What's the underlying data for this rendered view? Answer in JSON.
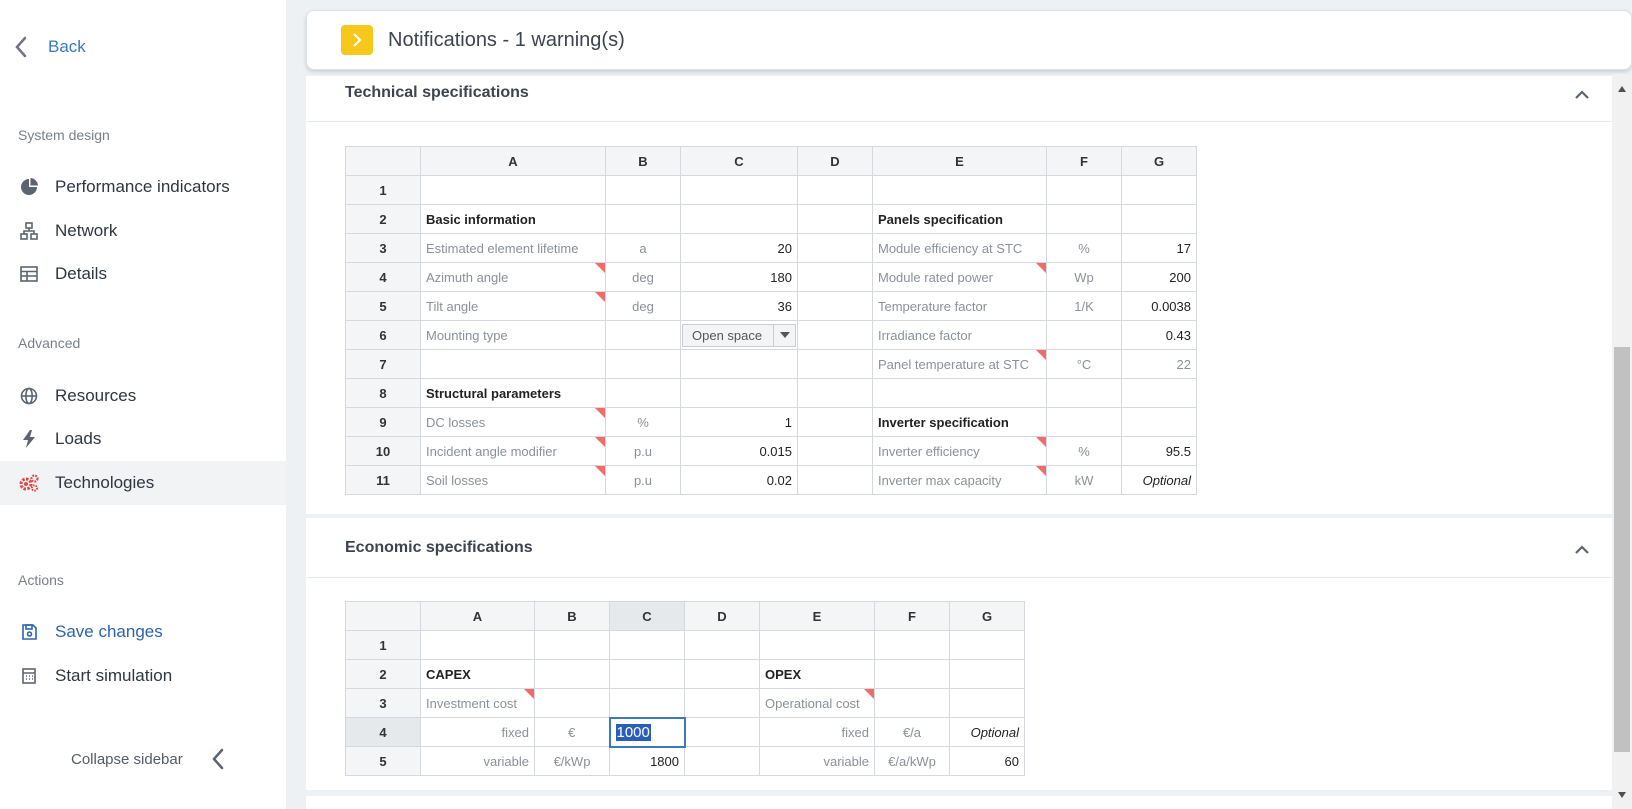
{
  "sidebar": {
    "back_label": "Back",
    "sections": {
      "system_design": "System design",
      "advanced": "Advanced",
      "actions": "Actions"
    },
    "items": {
      "performance": "Performance indicators",
      "network": "Network",
      "details": "Details",
      "resources": "Resources",
      "loads": "Loads",
      "technologies": "Technologies",
      "save": "Save changes",
      "start": "Start simulation"
    },
    "collapse_label": "Collapse sidebar"
  },
  "notifications": {
    "title": "Notifications - 1 warning(s)"
  },
  "technical": {
    "title": "Technical specifications",
    "columns": [
      "A",
      "B",
      "C",
      "D",
      "E",
      "F",
      "G"
    ],
    "rows": {
      "r2": {
        "a": "Basic information",
        "e": "Panels specification"
      },
      "r3": {
        "a": "Estimated element lifetime",
        "b": "a",
        "c": "20",
        "e": "Module efficiency at STC",
        "f": "%",
        "g": "17"
      },
      "r4": {
        "a": "Azimuth angle",
        "b": "deg",
        "c": "180",
        "e": "Module rated power",
        "f": "Wp",
        "g": "200"
      },
      "r5": {
        "a": "Tilt angle",
        "b": "deg",
        "c": "36",
        "e": "Temperature factor",
        "f": "1/K",
        "g": "0.0038"
      },
      "r6": {
        "a": "Mounting type",
        "c": "Open space",
        "e": "Irradiance factor",
        "g": "0.43"
      },
      "r7": {
        "e": "Panel temperature at STC",
        "f": "°C",
        "g": "22"
      },
      "r8": {
        "a": "Structural parameters"
      },
      "r9": {
        "a": "DC losses",
        "b": "%",
        "c": "1",
        "e": "Inverter specification"
      },
      "r10": {
        "a": "Incident angle modifier",
        "b": "p.u",
        "c": "0.015",
        "e": "Inverter efficiency",
        "f": "%",
        "g": "95.5"
      },
      "r11": {
        "a": "Soil losses",
        "b": "p.u",
        "c": "0.02",
        "e": "Inverter max capacity",
        "f": "kW",
        "g": "Optional"
      }
    }
  },
  "economic": {
    "title": "Economic specifications",
    "columns": [
      "A",
      "B",
      "C",
      "D",
      "E",
      "F",
      "G"
    ],
    "rows": {
      "r2": {
        "a": "CAPEX",
        "e": "OPEX"
      },
      "r3": {
        "a": "Investment cost",
        "e": "Operational cost"
      },
      "r4": {
        "a": "fixed",
        "b": "€",
        "c": "1000",
        "e": "fixed",
        "f": "€/a",
        "g": "Optional"
      },
      "r5": {
        "a": "variable",
        "b": "€/kWp",
        "c": "1800",
        "e": "variable",
        "f": "€/a/kWp",
        "g": "60"
      }
    }
  },
  "colors": {
    "accent_blue": "#3a78c2",
    "warning_yellow": "#f7c71a",
    "flag_red": "#f26b6b"
  },
  "icons": [
    "chevron-left-icon",
    "pie-chart-icon",
    "network-icon",
    "table-icon",
    "globe-icon",
    "lightning-icon",
    "gears-icon",
    "save-icon",
    "calculator-icon",
    "chevron-right-icon",
    "chevron-up-icon"
  ]
}
